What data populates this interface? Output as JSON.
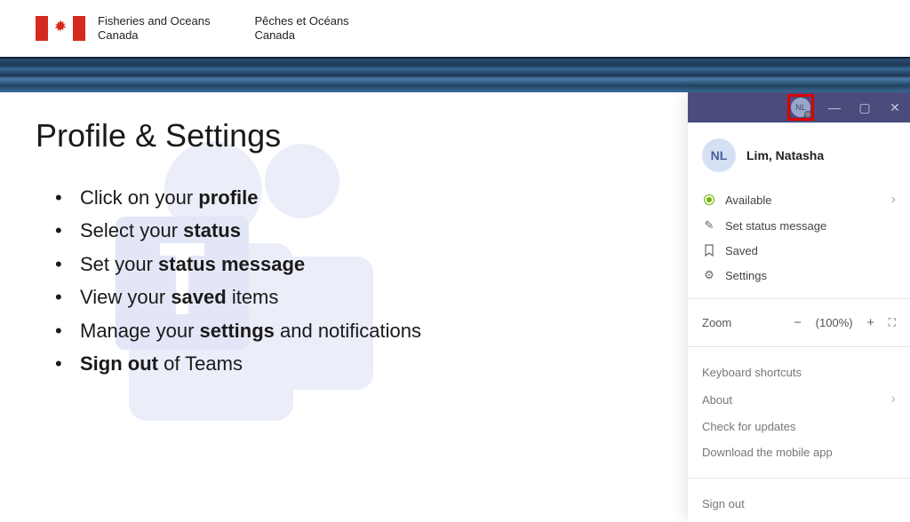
{
  "header": {
    "dept_en_line1": "Fisheries and Oceans",
    "dept_en_line2": "Canada",
    "dept_fr_line1": "Pêches et Océans",
    "dept_fr_line2": "Canada"
  },
  "slide": {
    "title": "Profile & Settings",
    "bullets": [
      {
        "pre": "Click on your ",
        "bold": "profile",
        "post": ""
      },
      {
        "pre": "Select your ",
        "bold": "status",
        "post": ""
      },
      {
        "pre": "Set your ",
        "bold": "status message",
        "post": ""
      },
      {
        "pre": "View your ",
        "bold": "saved",
        "post": " items"
      },
      {
        "pre": "Manage your ",
        "bold": "settings",
        "post": " and notifications"
      },
      {
        "pre": "",
        "bold": "Sign out",
        "post": " of Teams"
      }
    ]
  },
  "panel": {
    "initials": "NL",
    "name": "Lim, Natasha",
    "status": "Available",
    "set_status": "Set status message",
    "saved": "Saved",
    "settings": "Settings",
    "zoom_label": "Zoom",
    "zoom_value": "(100%)",
    "kb": "Keyboard shortcuts",
    "about": "About",
    "check": "Check for updates",
    "download": "Download the mobile app",
    "signout": "Sign out"
  }
}
